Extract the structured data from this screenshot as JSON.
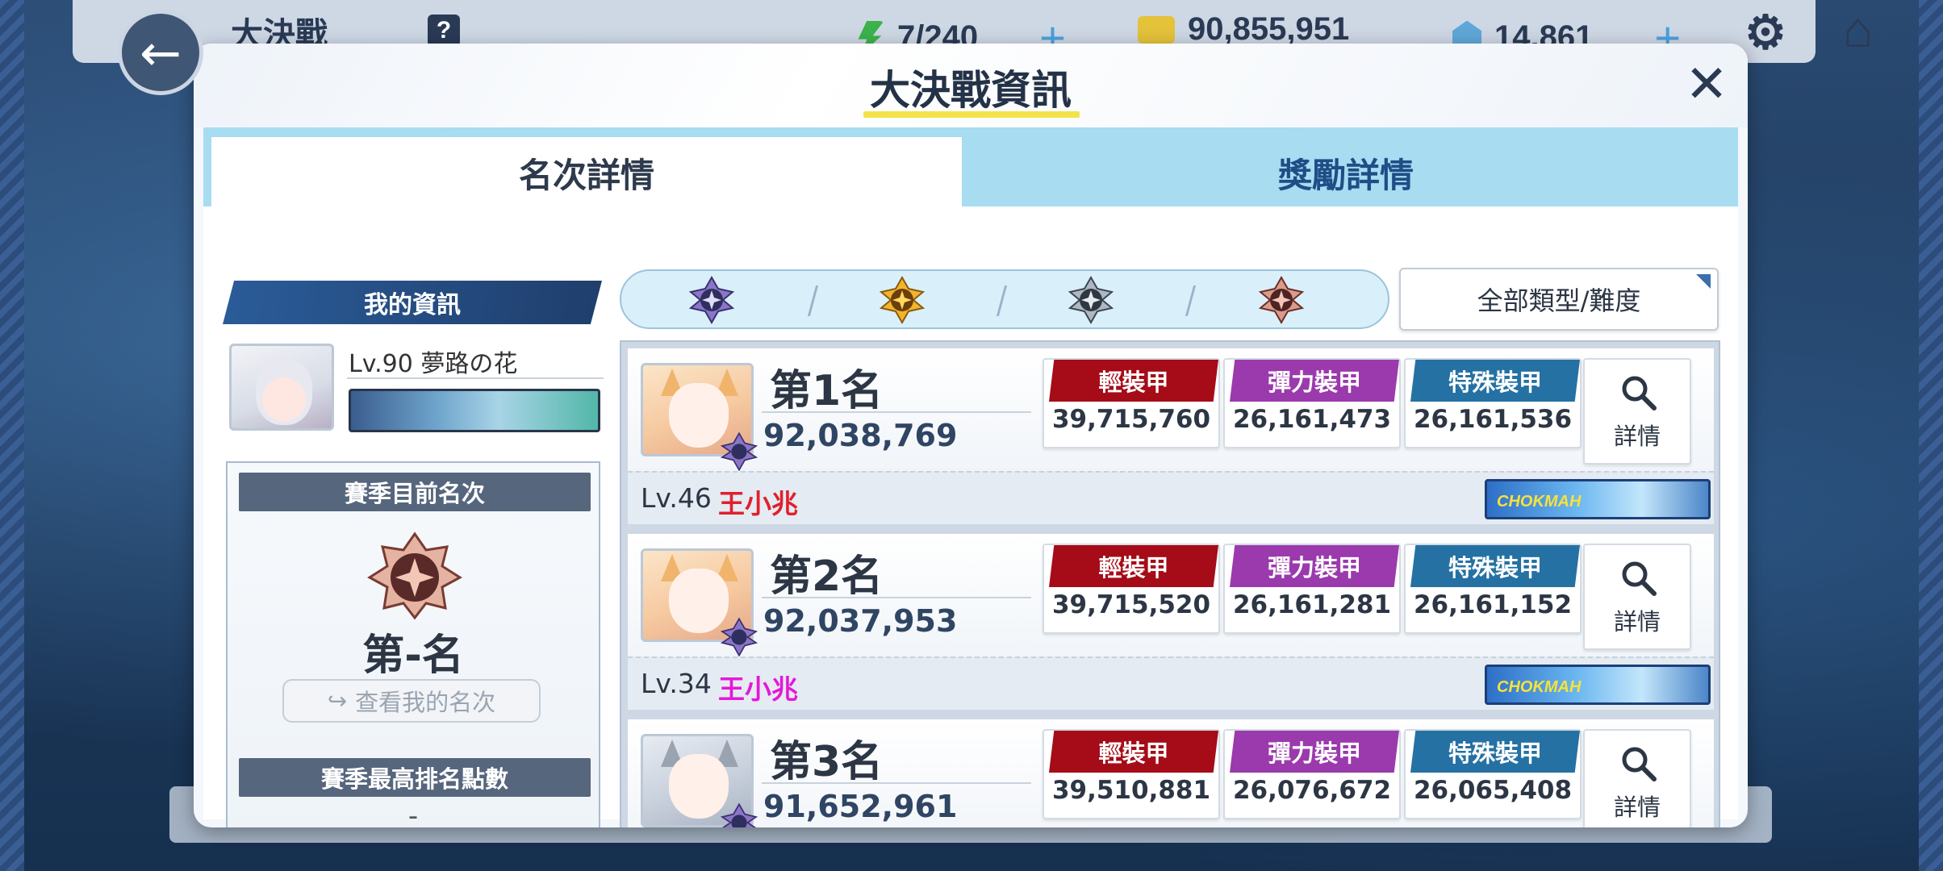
{
  "top_bar": {
    "title": "大決戰",
    "help_icon": "question-icon",
    "stamina": "7/240",
    "credits": "90,855,951",
    "gems": "14,861",
    "settings_icon": "gear-icon",
    "home_icon": "home-icon"
  },
  "modal": {
    "title": "大決戰資訊",
    "close_icon": "close-icon",
    "tabs": [
      {
        "label": "名次詳情",
        "active": true
      },
      {
        "label": "獎勵詳情",
        "active": false
      }
    ]
  },
  "my_info": {
    "header": "我的資訊",
    "level_name": "Lv.90 夢路の花",
    "season_rank_label": "賽季目前名次",
    "season_rank": "第-名",
    "check_rank_button": "查看我的名次",
    "best_points_label": "賽季最高排名點數",
    "best_points": "-"
  },
  "filters": {
    "tier_icons": [
      "platinum-tier-icon",
      "gold-tier-icon",
      "silver-tier-icon",
      "bronze-tier-icon"
    ],
    "type_dropdown": "全部類型/難度"
  },
  "rankings": [
    {
      "rank": "第1名",
      "score": "92,038,769",
      "armor": [
        {
          "type": "輕裝甲",
          "value": "39,715,760"
        },
        {
          "type": "彈力裝甲",
          "value": "26,161,473"
        },
        {
          "type": "特殊裝甲",
          "value": "26,161,536"
        }
      ],
      "detail_label": "詳情",
      "player_level": "Lv.46",
      "player_name": "王小兆",
      "name_color": "#e0202c",
      "club": "CHOKMAH"
    },
    {
      "rank": "第2名",
      "score": "92,037,953",
      "armor": [
        {
          "type": "輕裝甲",
          "value": "39,715,520"
        },
        {
          "type": "彈力裝甲",
          "value": "26,161,281"
        },
        {
          "type": "特殊裝甲",
          "value": "26,161,152"
        }
      ],
      "detail_label": "詳情",
      "player_level": "Lv.34",
      "player_name": "王小兆",
      "name_color": "#e418d8",
      "club": "CHOKMAH"
    },
    {
      "rank": "第3名",
      "score": "91,652,961",
      "armor": [
        {
          "type": "輕裝甲",
          "value": "39,510,881"
        },
        {
          "type": "彈力裝甲",
          "value": "26,076,672"
        },
        {
          "type": "特殊裝甲",
          "value": "26,065,408"
        }
      ],
      "detail_label": "詳情"
    }
  ],
  "colors": {
    "light_armor": "#a50c18",
    "elastic_armor": "#9b3aac",
    "special_armor": "#2571a3",
    "tab_bg": "#a7dcf1",
    "title_underline": "#f3e34a"
  }
}
